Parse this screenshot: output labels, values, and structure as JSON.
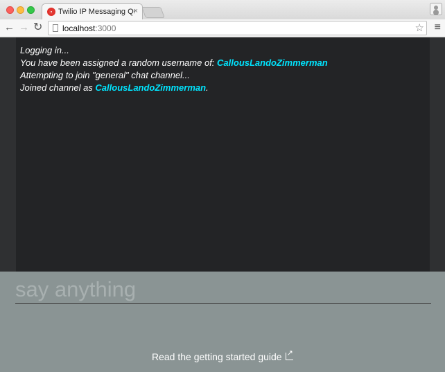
{
  "browser": {
    "tab": {
      "title": "Twilio IP Messaging Quickstart",
      "close": "×"
    },
    "url": {
      "host": "localhost",
      "port": ":3000"
    }
  },
  "log": {
    "line1": "Logging in...",
    "line2_prefix": "You have been assigned a random username of: ",
    "username": "CallousLandoZimmerman",
    "line3": "Attempting to join \"general\" chat channel...",
    "line4_prefix": "Joined channel as ",
    "line4_suffix": "."
  },
  "chat": {
    "placeholder": "say anything"
  },
  "footer": {
    "guide_link": "Read the getting started guide"
  },
  "colors": {
    "accent": "#00e5ff",
    "log_bg": "#232426",
    "footer_bg": "#8a9494"
  }
}
